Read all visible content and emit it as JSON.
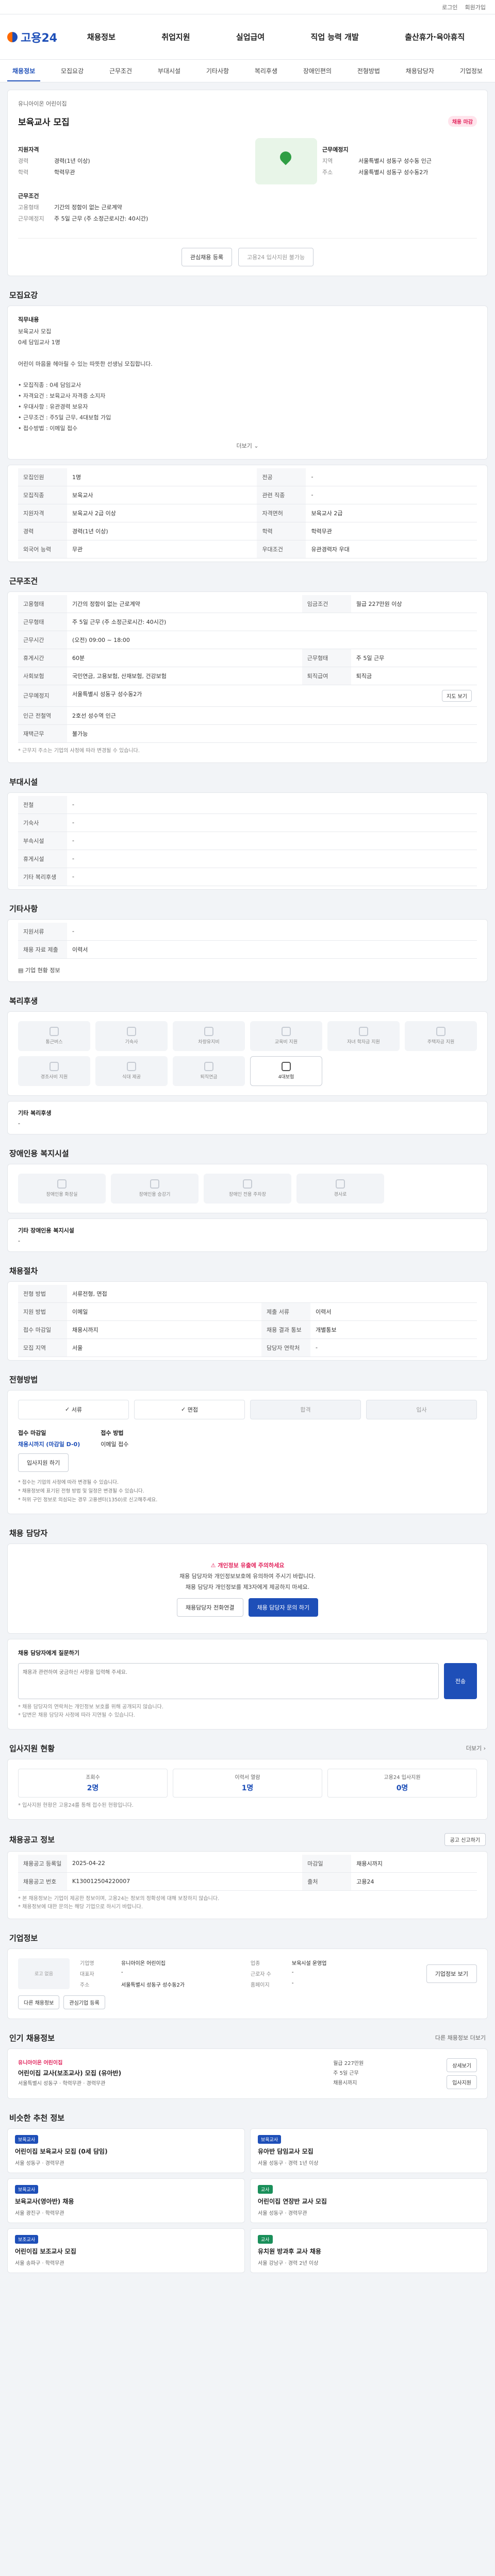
{
  "topbar": {
    "login": "로그인",
    "signup": "회원가입"
  },
  "brand": {
    "logo": "고용24"
  },
  "gnb": [
    "채용정보",
    "취업지원",
    "실업급여",
    "직업 능력 개발",
    "출산휴가·육아휴직"
  ],
  "tabs": [
    "채용정보",
    "모집요강",
    "근무조건",
    "부대시설",
    "기타사항",
    "복리후생",
    "장애인편의",
    "전형방법",
    "채용담당자",
    "기업정보"
  ],
  "hero": {
    "org": "유니아이온 어린이집",
    "title": "보육교사 모집",
    "badge": "채용 마감",
    "recruit_label": "지원자격",
    "recruit_rows": [
      {
        "k": "경력",
        "v": "경력(1년 이상)"
      },
      {
        "k": "학력",
        "v": "학력무관"
      }
    ],
    "work_label": "근무조건",
    "work_rows": [
      {
        "k": "고용형태",
        "v": "기간의 정함이 없는 근로계약"
      },
      {
        "k": "근무예정지",
        "v": "주 5일 근무 (주 소정근로시간: 40시간)"
      }
    ],
    "location_label": "근무예정지",
    "location_rows": [
      {
        "k": "지역",
        "v": "서울특별시 성동구 성수동 인근"
      },
      {
        "k": "주소",
        "v": "서울특별시 성동구 성수동2가"
      }
    ],
    "action_save": "관심채용 등록",
    "action_apply": "고용24 입사지원 불가능"
  },
  "recruit": {
    "title": "모집요강",
    "job_label": "직무내용",
    "job_text": "보육교사 모집\n0세 담임교사 1명\n\n어린이 마음을 헤아릴 수 있는 따뜻한 선생님 모집합니다.\n\n• 모집직종 : 0세 담임교사\n• 자격요건 : 보육교사 자격증 소지자\n• 우대사항 : 유관경력 보유자\n• 근무조건 : 주5일 근무, 4대보험 가입\n• 접수방법 : 이메일 접수",
    "more": "더보기",
    "rows": [
      [
        {
          "k": "모집인원",
          "v": "1명"
        },
        {
          "k": "전공",
          "v": "-"
        }
      ],
      [
        {
          "k": "모집직종",
          "v": "보육교사"
        },
        {
          "k": "관련 직종",
          "v": "-"
        }
      ],
      [
        {
          "k": "지원자격",
          "v": "보육교사 2급 이상"
        },
        {
          "k": "자격면허",
          "v": "보육교사 2급"
        }
      ],
      [
        {
          "k": "경력",
          "v": "경력(1년 이상)"
        },
        {
          "k": "학력",
          "v": "학력무관"
        }
      ],
      [
        {
          "k": "외국어 능력",
          "v": "무관"
        },
        {
          "k": "우대조건",
          "v": "유관경력자 우대"
        }
      ]
    ]
  },
  "work": {
    "title": "근무조건",
    "rows": [
      [
        {
          "k": "고용형태",
          "v": "기간의 정함이 없는 근로계약"
        },
        {
          "k": "임금조건",
          "v": "월급 227만원 이상"
        }
      ],
      [
        {
          "k": "근무형태",
          "v": "주 5일 근무 (주 소정근로시간: 40시간)"
        },
        {
          "k": "",
          "v": ""
        }
      ],
      [
        {
          "k": "근무시간",
          "v": "(오전) 09:00 ~ 18:00"
        },
        {
          "k": "",
          "v": ""
        }
      ],
      [
        {
          "k": "휴게시간",
          "v": "60분"
        },
        {
          "k": "근무형태",
          "v": "주 5일 근무"
        }
      ],
      [
        {
          "k": "사회보험",
          "v": "국민연금, 고용보험, 산재보험, 건강보험"
        },
        {
          "k": "퇴직급여",
          "v": "퇴직금"
        }
      ],
      [
        {
          "k": "근무예정지",
          "v": "서울특별시 성동구 성수동2가"
        },
        {
          "k": "",
          "v": ""
        }
      ],
      [
        {
          "k": "인근 전철역",
          "v": "2호선 성수역 인근"
        },
        {
          "k": "",
          "v": ""
        }
      ],
      [
        {
          "k": "재택근무",
          "v": "불가능"
        },
        {
          "k": "",
          "v": ""
        }
      ]
    ],
    "map_btn": "지도 보기",
    "note": "* 근무지 주소는 기업의 사정에 따라 변경될 수 있습니다."
  },
  "facility": {
    "title": "부대시설",
    "rows": [
      {
        "k": "전철",
        "v": "-"
      },
      {
        "k": "기숙사",
        "v": "-"
      },
      {
        "k": "부속시설",
        "v": "-"
      },
      {
        "k": "휴게시설",
        "v": "-"
      },
      {
        "k": "기타 복리후생",
        "v": "-"
      }
    ]
  },
  "etc": {
    "title": "기타사항",
    "rows": [
      {
        "k": "지원서류",
        "v": "-"
      },
      {
        "k": "채용 자료 제출",
        "v": "이력서"
      }
    ],
    "link": "기업 현황 정보"
  },
  "welfare": {
    "title": "복리후생",
    "items": [
      {
        "name": "통근버스",
        "on": false
      },
      {
        "name": "기숙사",
        "on": false
      },
      {
        "name": "차량유지비",
        "on": false
      },
      {
        "name": "교육비 지원",
        "on": false
      },
      {
        "name": "자녀 학자금 지원",
        "on": false
      },
      {
        "name": "주택자금 지원",
        "on": false
      },
      {
        "name": "경조사비 지원",
        "on": false
      },
      {
        "name": "식대 제공",
        "on": false
      },
      {
        "name": "퇴직연금",
        "on": false
      },
      {
        "name": "4대보험",
        "on": true
      }
    ],
    "etc_label": "기타 복리후생",
    "etc_value": "-"
  },
  "disabled": {
    "title": "장애인용 복지시설",
    "items": [
      "장애인용 화장실",
      "장애인용 승강기",
      "장애인 전용 주차장",
      "경사로"
    ],
    "etc_label": "기타 장애인용 복지시설",
    "etc_value": "-"
  },
  "selection": {
    "title": "채용절차",
    "rows": [
      [
        {
          "k": "전형 방법",
          "v": "서류전형, 면접"
        },
        {
          "k": "",
          "v": ""
        }
      ],
      [
        {
          "k": "지원 방법",
          "v": "이메일"
        },
        {
          "k": "제출 서류",
          "v": "이력서"
        }
      ],
      [
        {
          "k": "접수 마감일",
          "v": "채용시까지"
        },
        {
          "k": "채용 결과 통보",
          "v": "개별통보"
        }
      ],
      [
        {
          "k": "모집 지역",
          "v": "서울"
        },
        {
          "k": "담당자 연락처",
          "v": "-"
        }
      ]
    ]
  },
  "apply": {
    "title": "전형방법",
    "steps": [
      {
        "label": "서류",
        "on": true
      },
      {
        "label": "면접",
        "on": true
      },
      {
        "label": "합격",
        "on": false
      },
      {
        "label": "입사",
        "on": false
      }
    ],
    "deadline_label": "접수 마감일",
    "deadline_value": "채용시까지 (마감일 D-0)",
    "method_label": "접수 방법",
    "method_value": "이메일 접수",
    "apply_btn": "입사지원 하기",
    "notices": "* 접수는 기업의 사정에 따라 변경될 수 있습니다.\n* 채용정보에 표기된 전형 방법 및 일정은 변경될 수 있습니다.\n* 허위 구인 정보로 의심되는 경우 고용센터(1350)로 신고해주세요."
  },
  "contact": {
    "title": "채용 담당자",
    "line1": "채용 담당자와 개인정보보호에 유의하여 주시기 바랍니다.",
    "line2": "채용 담당자 개인정보를 제3자에게 제공하지 마세요.",
    "warn": "개인정보 유출에 주의하세요",
    "btn_phone": "채용담당자 전화연결",
    "btn_inquiry": "채용 담당자 문의 하기",
    "inquiry_label": "채용 담당자에게 질문하기",
    "inquiry_placeholder": "채용과 관련하여 궁금하신 사항을 입력해 주세요.",
    "send": "전송",
    "notes": "* 채용 담당자의 연락처는 개인정보 보호를 위해 공개되지 않습니다.\n* 답변은 채용 담당자 사정에 따라 지연될 수 있습니다."
  },
  "stats": {
    "title": "입사지원 현황",
    "link": "더보기",
    "items": [
      {
        "label": "조회수",
        "value": "2명"
      },
      {
        "label": "이력서 열람",
        "value": "1명"
      },
      {
        "label": "고용24 입사지원",
        "value": "0명"
      }
    ],
    "note": "* 입사지원 현황은 고용24를 통해 접수된 현황입니다."
  },
  "info": {
    "title": "채용공고 정보",
    "btn": "공고 신고하기",
    "rows": [
      [
        {
          "k": "채용공고 등록일",
          "v": "2025-04-22"
        },
        {
          "k": "마감일",
          "v": "채용시까지"
        }
      ],
      [
        {
          "k": "채용공고 번호",
          "v": "K130012504220007"
        },
        {
          "k": "출처",
          "v": "고용24"
        }
      ]
    ],
    "notes": "* 본 채용정보는 기업이 제공한 정보이며, 고용24는 정보의 정확성에 대해 보장하지 않습니다.\n* 채용정보에 대한 문의는 해당 기업으로 하시기 바랍니다."
  },
  "company": {
    "title": "기업정보",
    "logo": "로고 없음",
    "rows": [
      {
        "k": "기업명",
        "v": "유니아이온 어린이집"
      },
      {
        "k": "업종",
        "v": "보육시설 운영업"
      },
      {
        "k": "대표자",
        "v": "-"
      },
      {
        "k": "근로자 수",
        "v": "-"
      },
      {
        "k": "주소",
        "v": "서울특별시 성동구 성수동2가"
      },
      {
        "k": "홈페이지",
        "v": "-"
      }
    ],
    "btn1": "기업정보 보기",
    "btn2": "다른 채용정보",
    "btn3": "관심기업 등록"
  },
  "other": {
    "title": "인기 채용정보",
    "sub": "다른 채용정보 더보기",
    "org": "유니아이온 어린이집",
    "job": "어린이집 교사(보조교사) 모집 (유아반)",
    "meta": "서울특별시 성동구 · 학력무관 · 경력무관",
    "side": [
      "월급 227만원",
      "주 5일 근무",
      "채용시까지"
    ],
    "btn_more": "상세보기",
    "btn_apply": "입사지원"
  },
  "recommend": {
    "title": "비슷한 추천 정보",
    "cards": [
      {
        "tag": "보육교사",
        "title": "어린이집 보육교사 모집 (0세 담임)",
        "meta": "서울 성동구 · 경력무관"
      },
      {
        "tag": "보육교사",
        "title": "유아반 담임교사 모집",
        "meta": "서울 성동구 · 경력 1년 이상"
      },
      {
        "tag": "보육교사",
        "title": "보육교사(영아반) 채용",
        "meta": "서울 광진구 · 학력무관"
      },
      {
        "tag": "교사",
        "title": "어린이집 연장반 교사 모집",
        "meta": "서울 성동구 · 경력무관",
        "green": true
      },
      {
        "tag": "보조교사",
        "title": "어린이집 보조교사 모집",
        "meta": "서울 송파구 · 학력무관"
      },
      {
        "tag": "교사",
        "title": "유치원 방과후 교사 채용",
        "meta": "서울 강남구 · 경력 2년 이상",
        "green": true
      }
    ]
  },
  "colors": {
    "primary": "#1e4fb8",
    "accent": "#ff6a00",
    "alert": "#e2245c"
  }
}
